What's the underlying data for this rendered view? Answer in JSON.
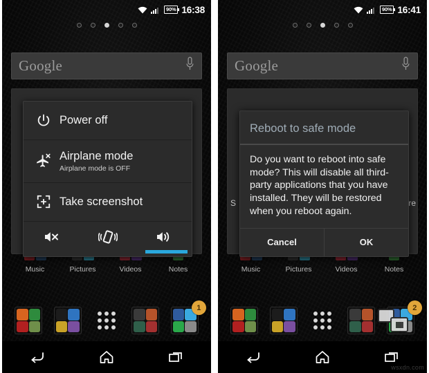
{
  "panels": [
    {
      "id": "left",
      "status": {
        "time": "16:38",
        "battery": "90%",
        "wifi_icon": "wifi-icon",
        "signal_icon": "signal-icon",
        "battery_icon": "battery-icon"
      },
      "search": {
        "text": "Google",
        "mic_icon": "microphone-icon"
      },
      "page_dots": {
        "count": 5,
        "active_index": 2
      },
      "shelf": {
        "labels": [
          "Music",
          "Pictures",
          "Videos",
          "Notes"
        ]
      },
      "dock": {
        "badge": "1",
        "drawer_icon": "app-drawer-icon"
      },
      "navbar": {
        "back": "back-icon",
        "home": "home-icon",
        "recents": "recents-icon"
      },
      "overlay": {
        "type": "power-menu",
        "items": [
          {
            "icon": "power-icon",
            "title": "Power off",
            "subtitle": ""
          },
          {
            "icon": "airplane-icon",
            "title": "Airplane mode",
            "subtitle": "Airplane mode is OFF"
          },
          {
            "icon": "screenshot-icon",
            "title": "Take screenshot",
            "subtitle": ""
          }
        ],
        "sound_row": [
          {
            "icon": "mute-icon",
            "label": "Silent",
            "selected": false
          },
          {
            "icon": "vibrate-icon",
            "label": "Vibrate",
            "selected": false
          },
          {
            "icon": "speaker-icon",
            "label": "Sound",
            "selected": true
          }
        ],
        "accent_color": "#2aa8dd"
      }
    },
    {
      "id": "right",
      "status": {
        "time": "16:41",
        "battery": "90%",
        "wifi_icon": "wifi-icon",
        "signal_icon": "signal-icon",
        "battery_icon": "battery-icon"
      },
      "search": {
        "text": "Google",
        "mic_icon": "microphone-icon"
      },
      "page_dots": {
        "count": 5,
        "active_index": 2
      },
      "shelf": {
        "labels": [
          "Music",
          "Pictures",
          "Videos",
          "Notes"
        ]
      },
      "dock": {
        "badge": "2",
        "drawer_icon": "app-drawer-icon"
      },
      "navbar": {
        "back": "back-icon",
        "home": "home-icon",
        "recents": "recents-icon"
      },
      "overlay": {
        "type": "dialog",
        "title": "Reboot to safe mode",
        "message": "Do you want to reboot into safe mode? This will disable all third-party applications that you have installed. They will be restored when you reboot again.",
        "buttons": [
          "Cancel",
          "OK"
        ],
        "peek_left": "S",
        "peek_right": "re",
        "accent_color": "#2aa8dd"
      }
    }
  ],
  "watermark": "wsxdn.com",
  "colors": {
    "panel_bg": "#2b2b2b",
    "accent": "#2aa8dd",
    "title_blue": "#9facb6",
    "badge": "#e2a63a"
  }
}
